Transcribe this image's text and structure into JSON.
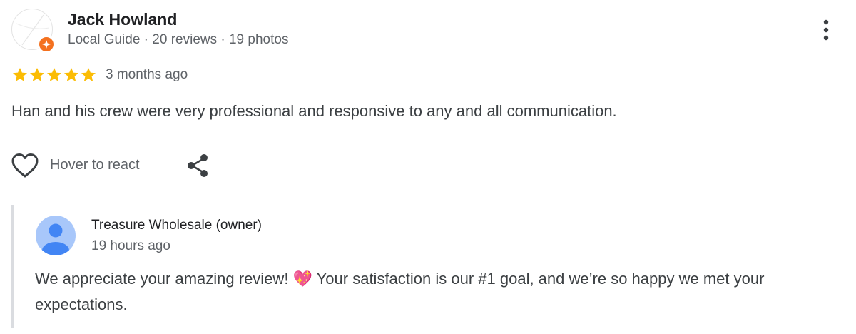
{
  "reviewer": {
    "name": "Jack Howland",
    "meta": "Local Guide · 20 reviews · 19 photos",
    "avatar_icon": "reviewer-avatar-icon",
    "badge_icon": "local-guide-badge-icon"
  },
  "rating": {
    "stars": 5,
    "max_stars": 5,
    "time": "3 months ago",
    "star_color": "#fbbc04"
  },
  "review": {
    "text": "Han and his crew were very professional and responsive to any and all communication."
  },
  "actions": {
    "react_label": "Hover to react",
    "like_icon": "heart-outline-icon",
    "share_icon": "share-icon",
    "more_icon": "more-vert-icon"
  },
  "response": {
    "owner_name": "Treasure Wholesale (owner)",
    "time": "19 hours ago",
    "text": "We appreciate your amazing review! 💖 Your satisfaction is our #1 goal, and we’re so happy we met your expectations.",
    "avatar_icon": "default-user-avatar-icon"
  },
  "colors": {
    "accent_badge": "#f4711f",
    "text_primary": "#202124",
    "text_secondary": "#5f6368",
    "owner_avatar_bg": "#a8c7fa",
    "owner_avatar_fg": "#4285f4"
  }
}
